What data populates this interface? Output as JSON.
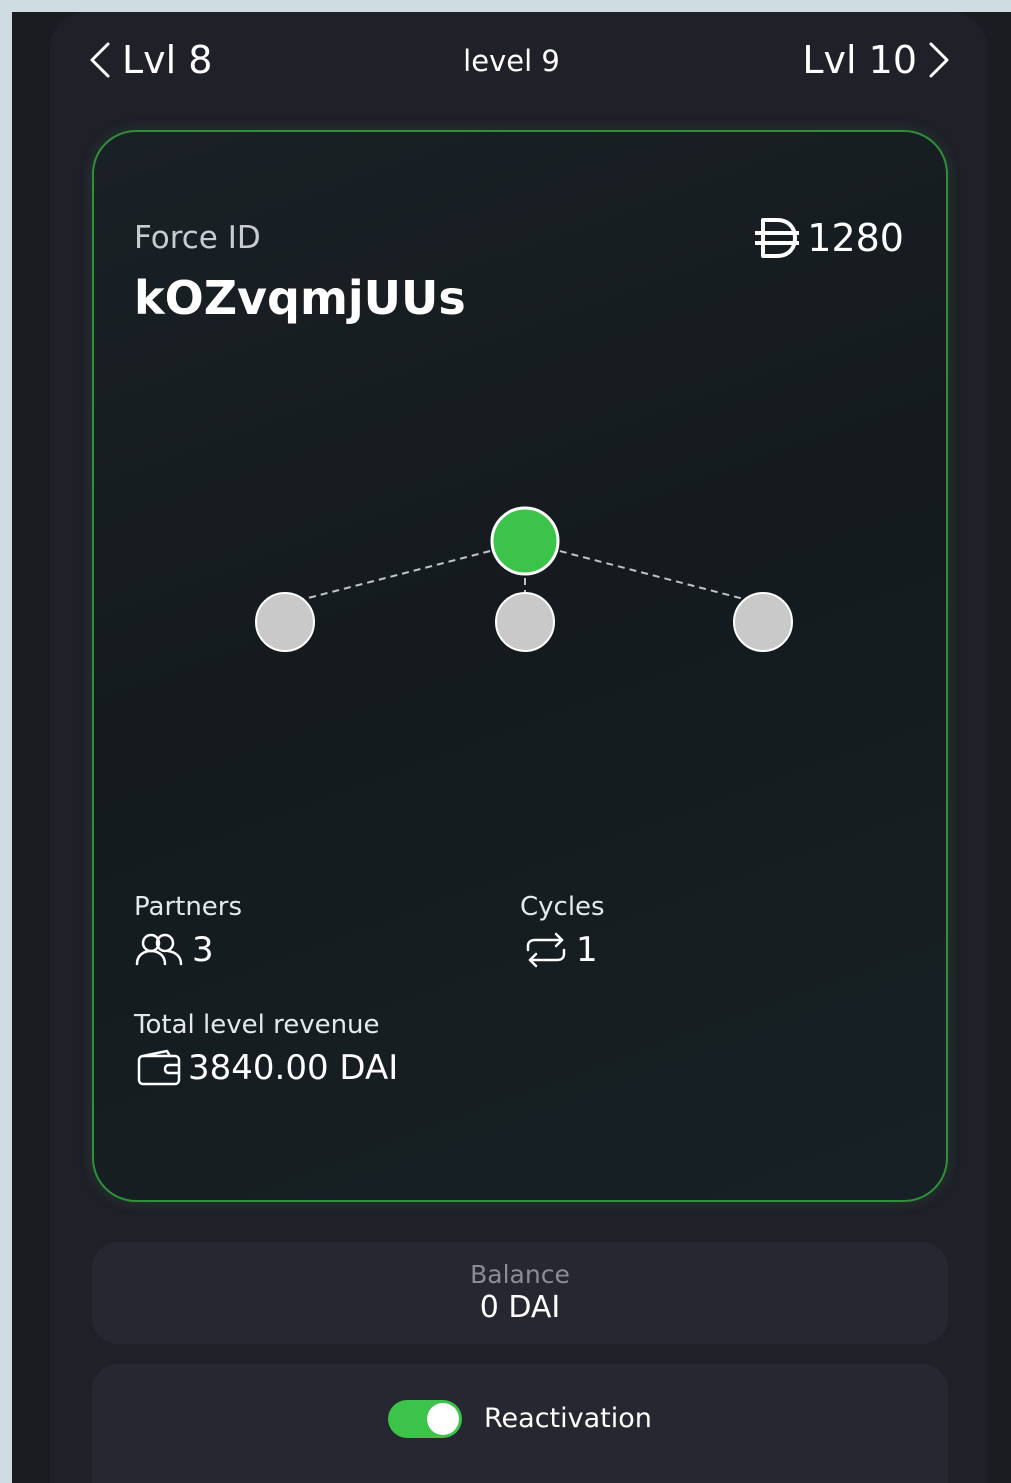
{
  "nav": {
    "prev_label": "Lvl 8",
    "current_label": "level 9",
    "next_label": "Lvl 10"
  },
  "card": {
    "force_id_label": "Force ID",
    "force_id_value": "kOZvqmjUUs",
    "price": "1280",
    "price_icon": "dai-currency-icon",
    "tree": {
      "root": {
        "status": "filled",
        "color": "#3cc44a"
      },
      "children": [
        {
          "status": "empty",
          "color": "#c9c9c9"
        },
        {
          "status": "empty",
          "color": "#c9c9c9"
        },
        {
          "status": "empty",
          "color": "#c9c9c9"
        }
      ]
    },
    "partners_label": "Partners",
    "partners_value": "3",
    "partners_icon": "users-icon",
    "cycles_label": "Cycles",
    "cycles_value": "1",
    "cycles_icon": "repeat-icon",
    "revenue_label": "Total level revenue",
    "revenue_value": "3840.00 DAI",
    "revenue_icon": "wallet-icon"
  },
  "balance": {
    "label": "Balance",
    "value": "0 DAI"
  },
  "reactivation": {
    "label": "Reactivation",
    "enabled": true
  },
  "colors": {
    "accent_green": "#3cc44a",
    "card_border": "#2f8f3a",
    "background": "#1f2028"
  }
}
